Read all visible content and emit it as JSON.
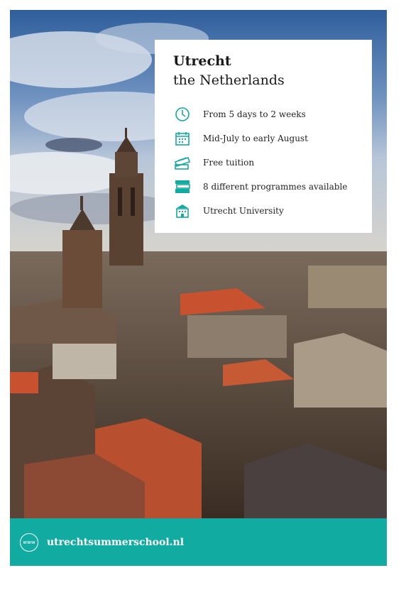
{
  "card": {
    "title": "Utrecht",
    "subtitle": "the Netherlands",
    "features": [
      {
        "icon": "clock-icon",
        "text": "From 5 days to 2 weeks"
      },
      {
        "icon": "calendar-icon",
        "text": "Mid-July to early August"
      },
      {
        "icon": "tuition-ticket-icon",
        "text": "Free tuition"
      },
      {
        "icon": "books-stack-icon",
        "text": "8 different programmes available"
      },
      {
        "icon": "university-building-icon",
        "text": "Utrecht University"
      }
    ]
  },
  "footer": {
    "www_label": "www",
    "url": "utrechtsummerschool.nl"
  },
  "colors": {
    "accent": "#12aba1",
    "card_background": "#ffffff",
    "sky": "#3d6aa8",
    "roof": "#c8512f"
  }
}
